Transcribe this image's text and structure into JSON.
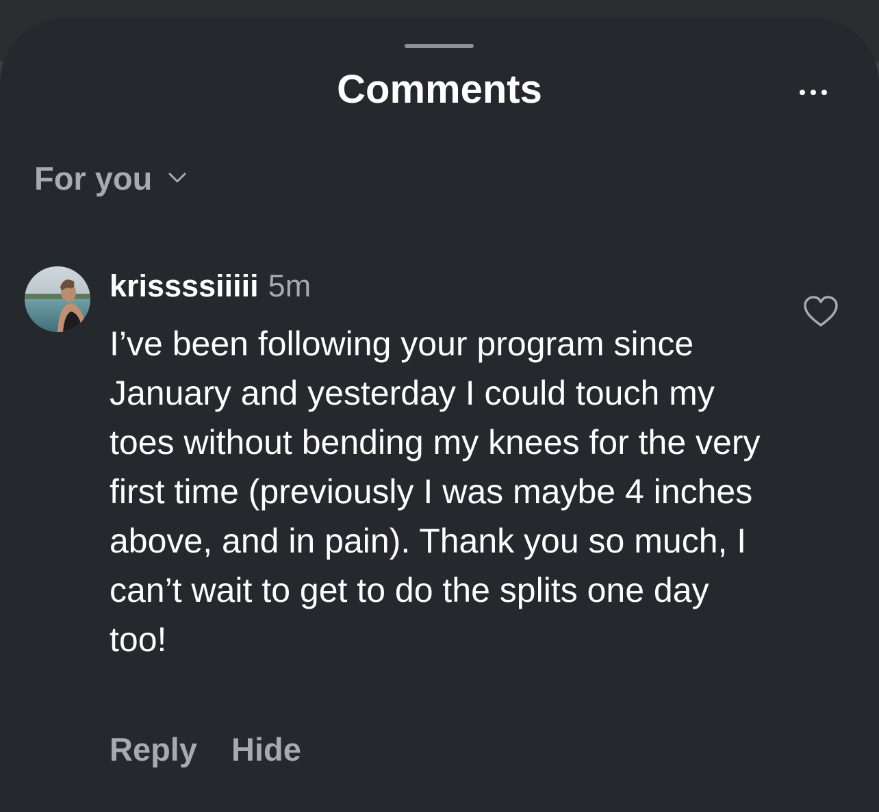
{
  "sheet": {
    "title": "Comments",
    "more_icon": "ellipsis-icon"
  },
  "sort": {
    "label": "For you",
    "icon": "chevron-down-icon"
  },
  "comment": {
    "avatar_icon": "avatar",
    "username": "krissssiiiii",
    "timestamp": "5m",
    "text": "I’ve been following your program since January and yesterday I could touch my toes without bending my knees for the very first time (previously I was maybe 4 inches above, and in pain). Thank you so much, I can’t wait to get to do the splits one day too!",
    "like_icon": "heart-icon",
    "actions": {
      "reply": "Reply",
      "hide": "Hide"
    }
  },
  "colors": {
    "sheet_background": "#25282c",
    "primary_text": "#ffffff",
    "secondary_text": "#a7aaae"
  }
}
